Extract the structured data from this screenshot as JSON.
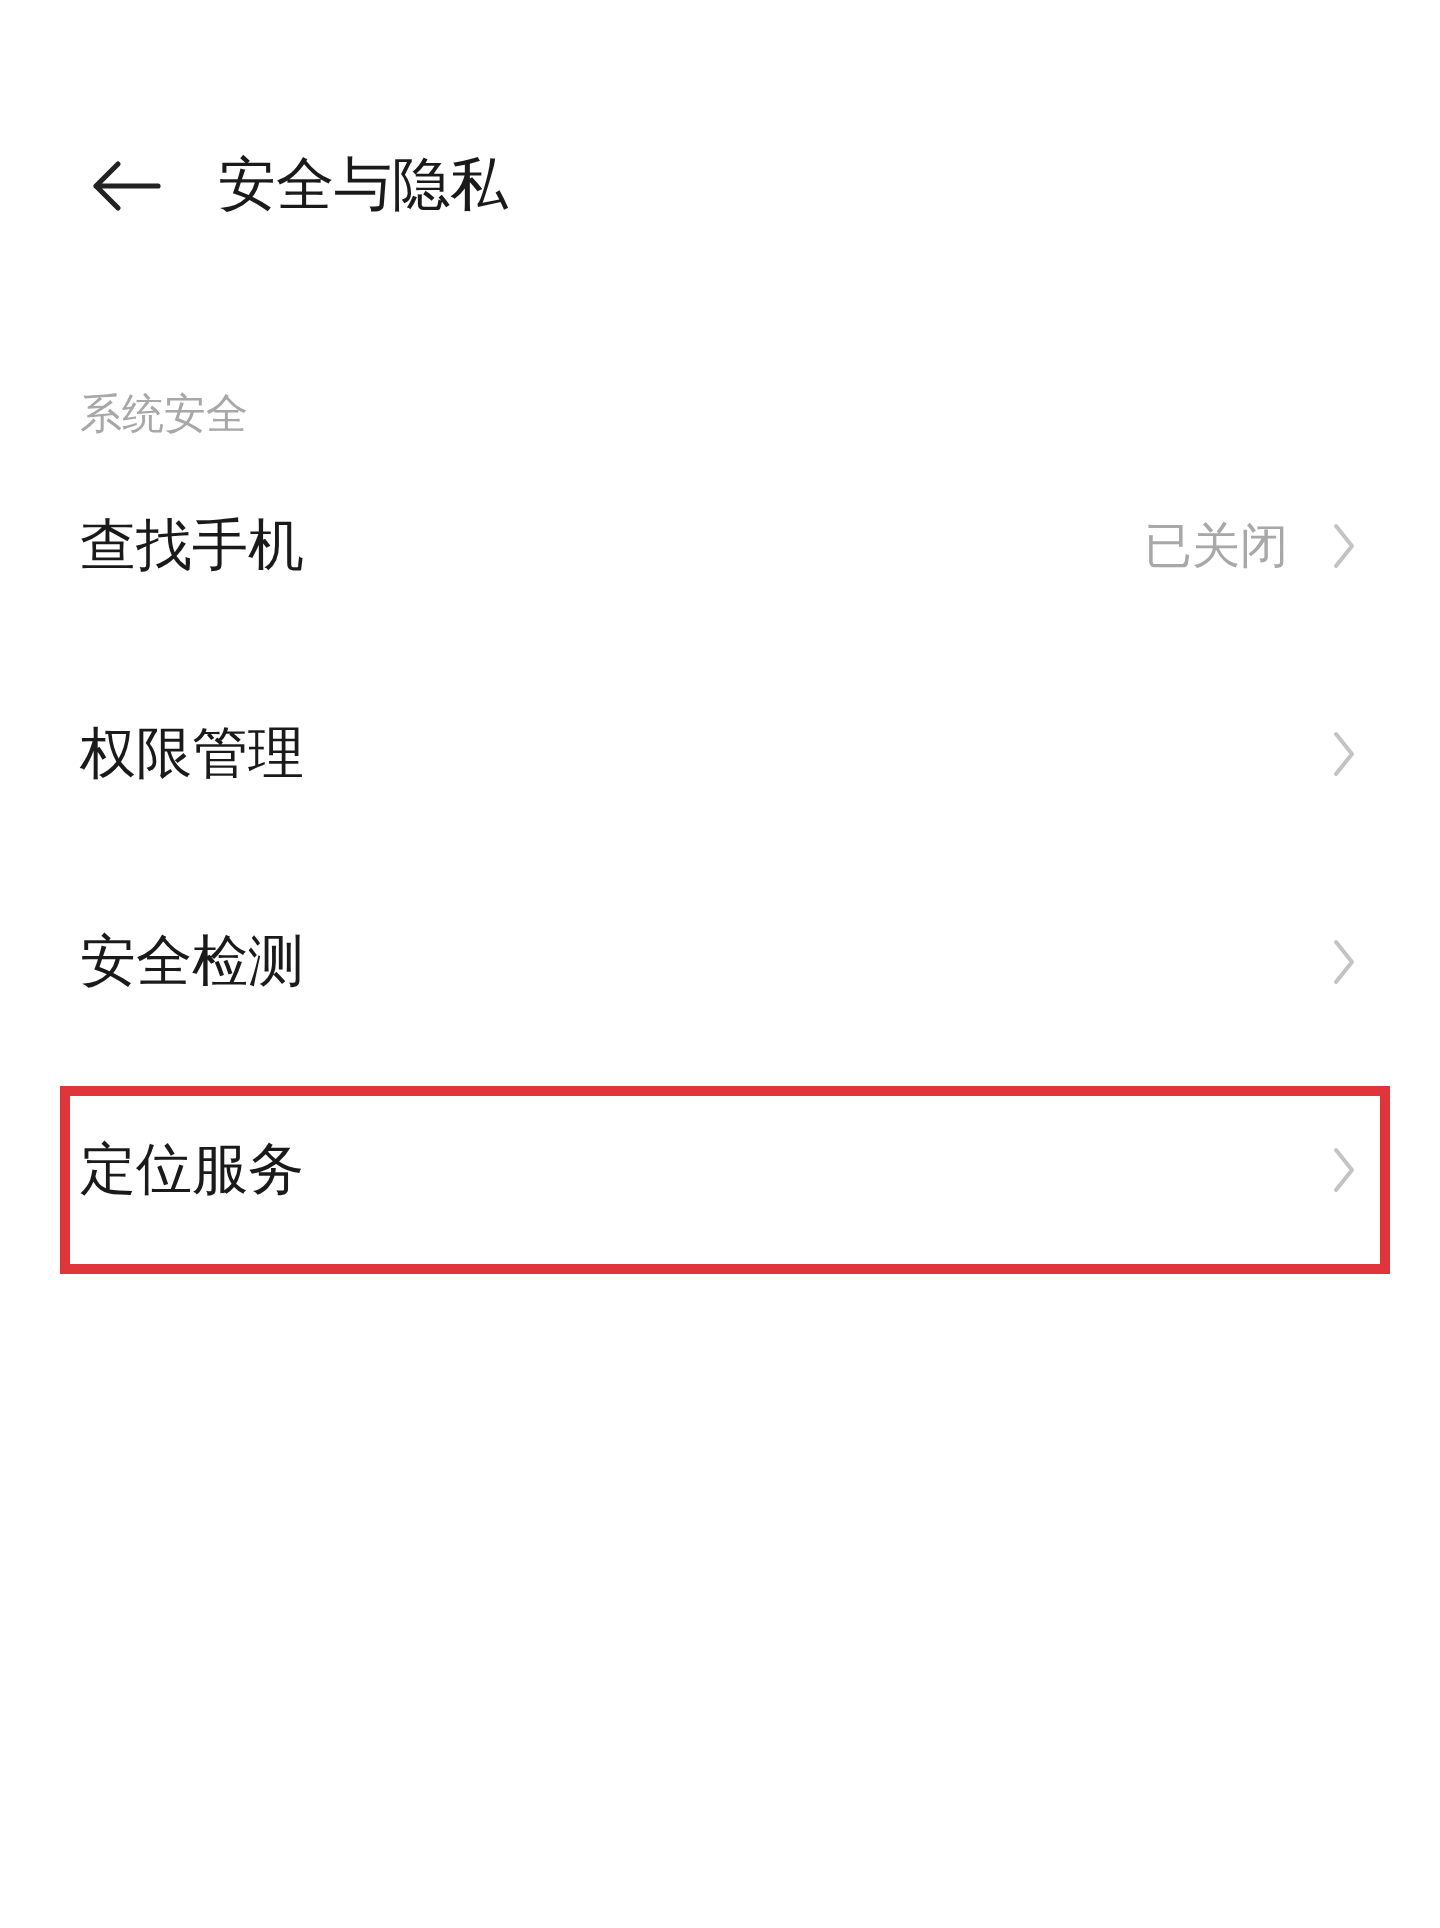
{
  "header": {
    "title": "安全与隐私"
  },
  "section": {
    "label": "系统安全"
  },
  "items": [
    {
      "label": "查找手机",
      "value": "已关闭",
      "highlighted": false
    },
    {
      "label": "权限管理",
      "highlighted": false
    },
    {
      "label": "安全检测",
      "highlighted": false
    },
    {
      "label": "定位服务",
      "highlighted": true
    }
  ]
}
